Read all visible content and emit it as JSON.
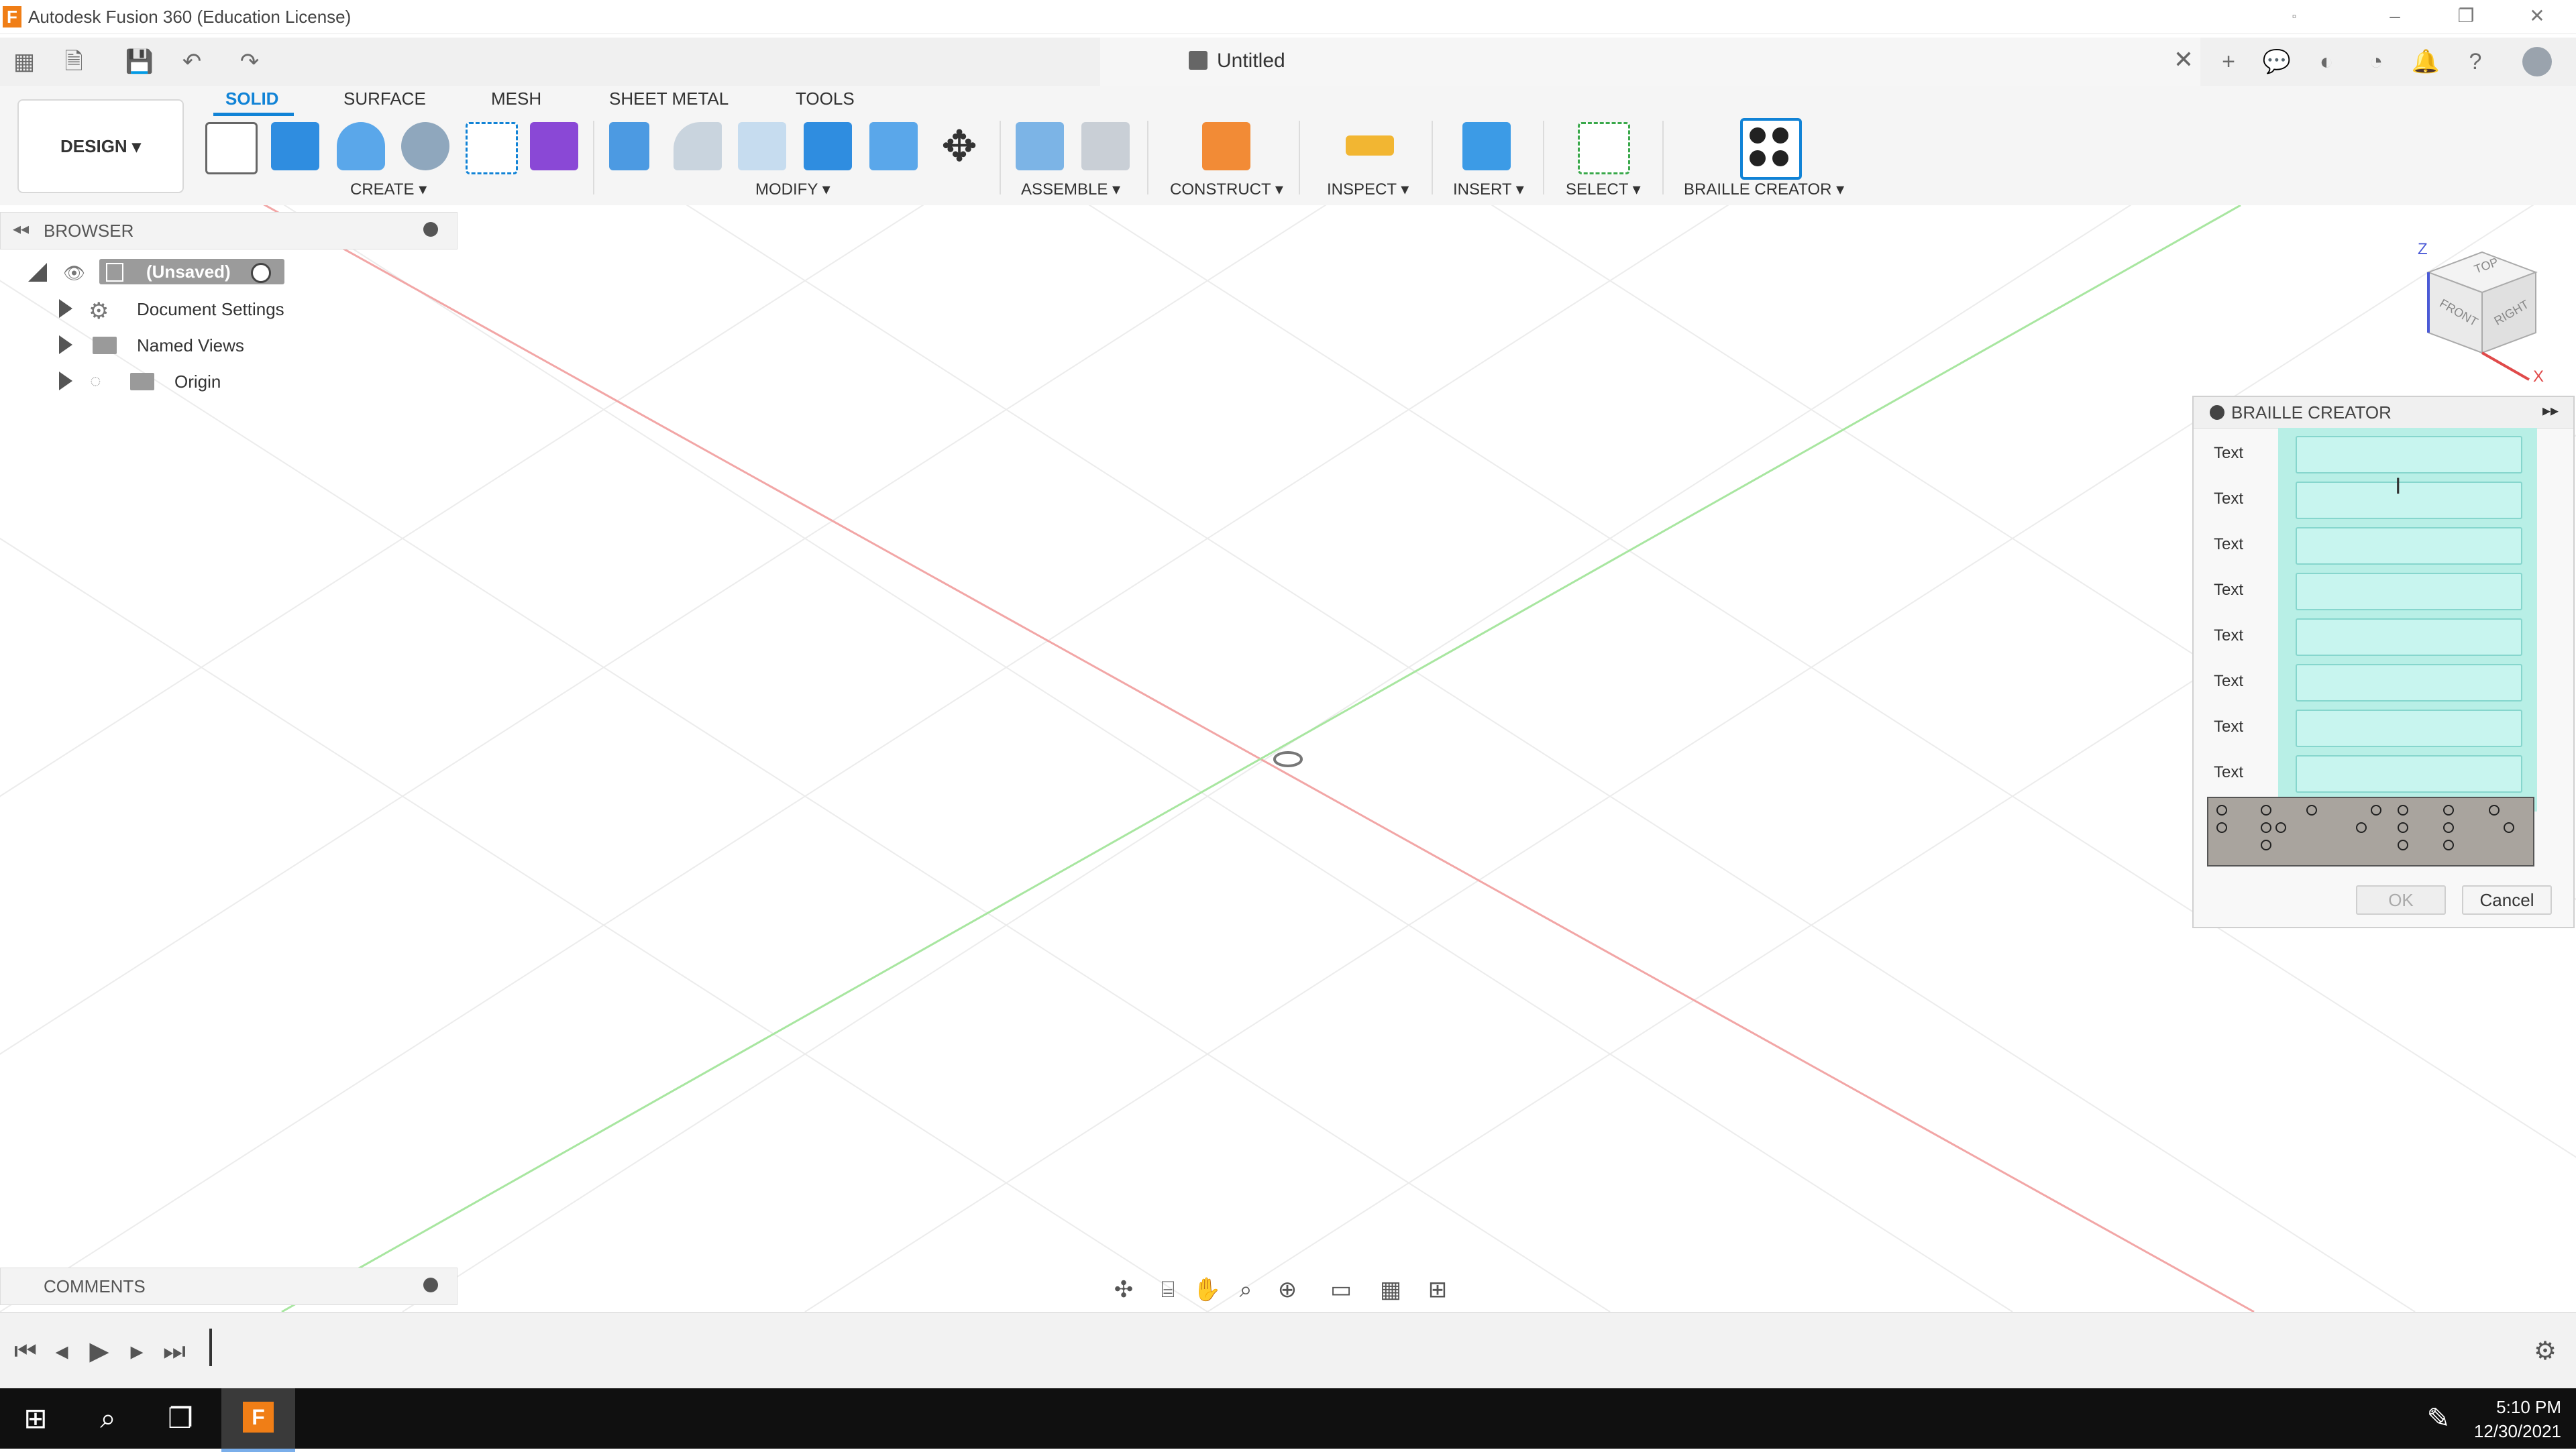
{
  "window": {
    "title": "Autodesk Fusion 360 (Education License)"
  },
  "doc": {
    "tab_title": "Untitled"
  },
  "toolbar": {
    "design_label": "DESIGN ▾",
    "tabs": [
      "SOLID",
      "SURFACE",
      "MESH",
      "SHEET METAL",
      "TOOLS"
    ],
    "groups": {
      "create": "CREATE ▾",
      "modify": "MODIFY ▾",
      "assemble": "ASSEMBLE ▾",
      "construct": "CONSTRUCT ▾",
      "inspect": "INSPECT ▾",
      "insert": "INSERT ▾",
      "select": "SELECT ▾",
      "braille": "BRAILLE CREATOR ▾"
    }
  },
  "browser": {
    "header": "BROWSER",
    "root": "(Unsaved)",
    "items": [
      "Document Settings",
      "Named Views",
      "Origin"
    ]
  },
  "braille_panel": {
    "title": "BRAILLE CREATOR",
    "row_labels": [
      "Text",
      "Text",
      "Text",
      "Text",
      "Text",
      "Text",
      "Text",
      "Text"
    ],
    "ok": "OK",
    "cancel": "Cancel"
  },
  "viewcube": {
    "top": "TOP",
    "front": "FRONT",
    "right": "RIGHT",
    "z": "Z",
    "x": "X"
  },
  "comments": {
    "header": "COMMENTS"
  },
  "taskbar": {
    "time": "5:10 PM",
    "date": "12/30/2021"
  },
  "colors": {
    "accent": "#1183d6",
    "panel_teal": "#b8efe6",
    "axis_red": "#f2a6a6",
    "axis_green": "#a8e6a0"
  }
}
